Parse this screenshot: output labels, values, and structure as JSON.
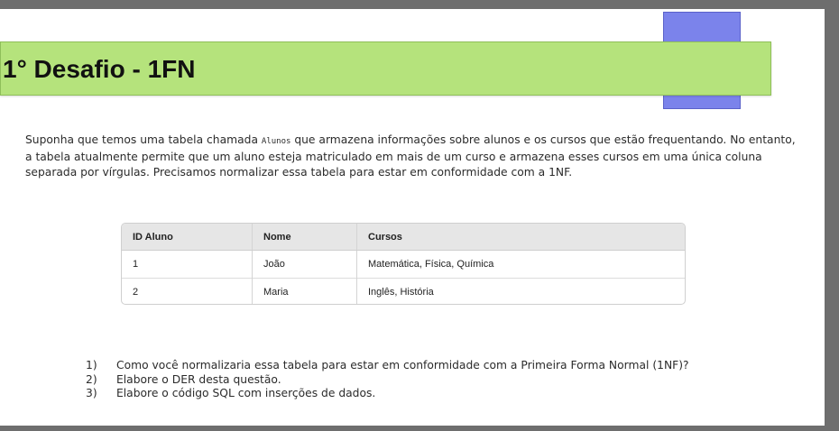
{
  "slide": {
    "title": "1° Desafio - 1FN",
    "intro_before": "Suponha que temos uma tabela chamada ",
    "intro_code": "Alunos",
    "intro_after": " que armazena informações sobre alunos e os cursos que estão frequentando. No entanto, a tabela atualmente permite que um aluno esteja matriculado em mais de um curso e armazena esses cursos em uma única coluna separada por vírgulas. Precisamos normalizar essa tabela para estar em conformidade com a 1NF.",
    "table": {
      "headers": [
        "ID Aluno",
        "Nome",
        "Cursos"
      ],
      "rows": [
        [
          "1",
          "João",
          "Matemática, Física, Química"
        ],
        [
          "2",
          "Maria",
          "Inglês, História"
        ]
      ]
    },
    "questions": [
      {
        "num": "1)",
        "text": "Como você normalizaria essa tabela para estar em conformidade com a Primeira Forma Normal (1NF)?"
      },
      {
        "num": "2)",
        "text": "Elabore o DER desta questão."
      },
      {
        "num": "3)",
        "text": "Elabore o código SQL com inserções de dados."
      }
    ]
  },
  "colors": {
    "title_bar": "#b5e37c",
    "accent_box": "#7b83eb",
    "frame": "#6e6e6e"
  }
}
